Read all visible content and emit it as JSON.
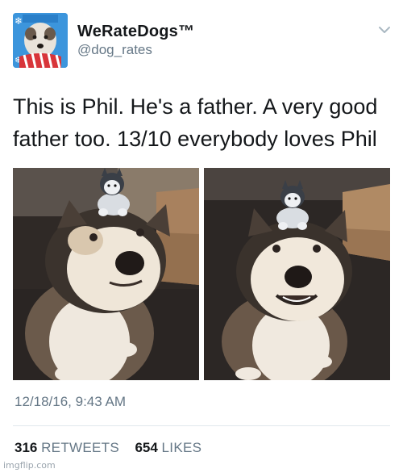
{
  "tweet": {
    "display_name": "WeRateDogs™",
    "handle": "@dog_rates",
    "text_line_1": "This is Phil. He's a father. A very good",
    "text_line_2": "father too. 13/10 everybody loves Phil",
    "timestamp": "12/18/16, 9:43 AM",
    "retweets_count": "316",
    "retweets_label": "RETWEETS",
    "likes_count": "654",
    "likes_label": "LIKES"
  },
  "icons": {
    "menu": "chevron-down-icon",
    "avatar": "avatar"
  },
  "colors": {
    "text_primary": "#14171a",
    "text_secondary": "#657786",
    "divider": "#e1e8ed"
  },
  "watermark": "imgflip.com"
}
